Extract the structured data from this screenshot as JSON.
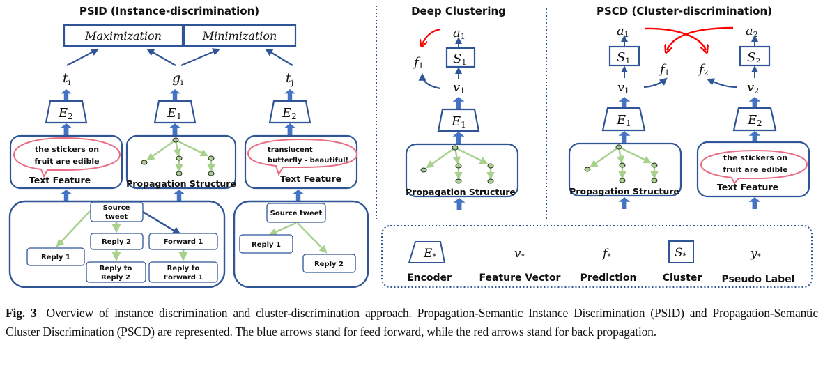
{
  "colors": {
    "blue": "#2F5597",
    "arrow_blue": "#4472C4",
    "green": "#A9D18E",
    "node_fill": "#A9D18E",
    "red": "#FF0000",
    "bubble": "#E96D84"
  },
  "psid": {
    "title": "PSID (Instance-discrimination)",
    "maximization": "Maximization",
    "minimization": "Minimization",
    "t_i": {
      "base": "t",
      "sub": "i"
    },
    "g_i": {
      "base": "g",
      "sub": "i"
    },
    "t_j": {
      "base": "t",
      "sub": "j"
    },
    "encoder_left": {
      "base": "E",
      "sub": "2"
    },
    "encoder_mid": {
      "base": "E",
      "sub": "1"
    },
    "encoder_right": {
      "base": "E",
      "sub": "2"
    },
    "text_feature_left": {
      "bubble_line1": "the stickers on",
      "bubble_line2": "fruit are edible",
      "label": "Text Feature"
    },
    "propagation_mid": {
      "label": "Propagation Structure"
    },
    "text_feature_right": {
      "bubble_line1": "translucent",
      "bubble_line2": "butterfly - beautiful!",
      "label": "Text Feature"
    },
    "tree_left": {
      "source_line1": "Source",
      "source_line2": "tweet",
      "reply1": "Reply 1",
      "reply2": "Reply 2",
      "forward1": "Forward 1",
      "reply_to_reply2_line1": "Reply to",
      "reply_to_reply2_line2": "Reply 2",
      "reply_to_forward1_line1": "Reply to",
      "reply_to_forward1_line2": "Forward 1"
    },
    "tree_right": {
      "source": "Source tweet",
      "reply1": "Reply 1",
      "reply2": "Reply 2"
    }
  },
  "deep_clustering": {
    "title": "Deep Clustering",
    "a1": {
      "base": "a",
      "sub": "1"
    },
    "s1": {
      "base": "S",
      "sub": "1"
    },
    "f1": {
      "base": "f",
      "sub": "1"
    },
    "v1": {
      "base": "v",
      "sub": "1"
    },
    "e1": {
      "base": "E",
      "sub": "1"
    },
    "propagation_label": "Propagation Structure"
  },
  "pscd": {
    "title": "PSCD (Cluster-discrimination)",
    "a1": {
      "base": "a",
      "sub": "1"
    },
    "a2": {
      "base": "a",
      "sub": "2"
    },
    "s1": {
      "base": "S",
      "sub": "1"
    },
    "s2": {
      "base": "S",
      "sub": "2"
    },
    "f1": {
      "base": "f",
      "sub": "1"
    },
    "f2": {
      "base": "f",
      "sub": "2"
    },
    "v1": {
      "base": "v",
      "sub": "1"
    },
    "v2": {
      "base": "v",
      "sub": "2"
    },
    "e1": {
      "base": "E",
      "sub": "1"
    },
    "e2": {
      "base": "E",
      "sub": "2"
    },
    "propagation_label": "Propagation Structure",
    "text_feature": {
      "bubble_line1": "the stickers on",
      "bubble_line2": "fruit are edible",
      "label": "Text Feature"
    }
  },
  "legend": {
    "items": [
      {
        "symbol": {
          "base": "E",
          "sub": "*"
        },
        "label": "Encoder"
      },
      {
        "symbol": {
          "base": "v",
          "sub": "*"
        },
        "label": "Feature Vector"
      },
      {
        "symbol": {
          "base": "f",
          "sub": "*"
        },
        "label": "Prediction"
      },
      {
        "symbol": {
          "base": "S",
          "sub": "*"
        },
        "label": "Cluster"
      },
      {
        "symbol": {
          "base": "y",
          "sub": "*"
        },
        "label": "Pseudo Label"
      }
    ]
  },
  "caption": {
    "fig_label": "Fig. 3",
    "text": "Overview of instance discrimination and cluster-discrimination approach. Propagation-Semantic Instance Discrimination (PSID) and Propagation-Semantic Cluster Discrimination (PSCD) are represented. The blue arrows stand for feed forward, while the red arrows stand for back propagation."
  }
}
